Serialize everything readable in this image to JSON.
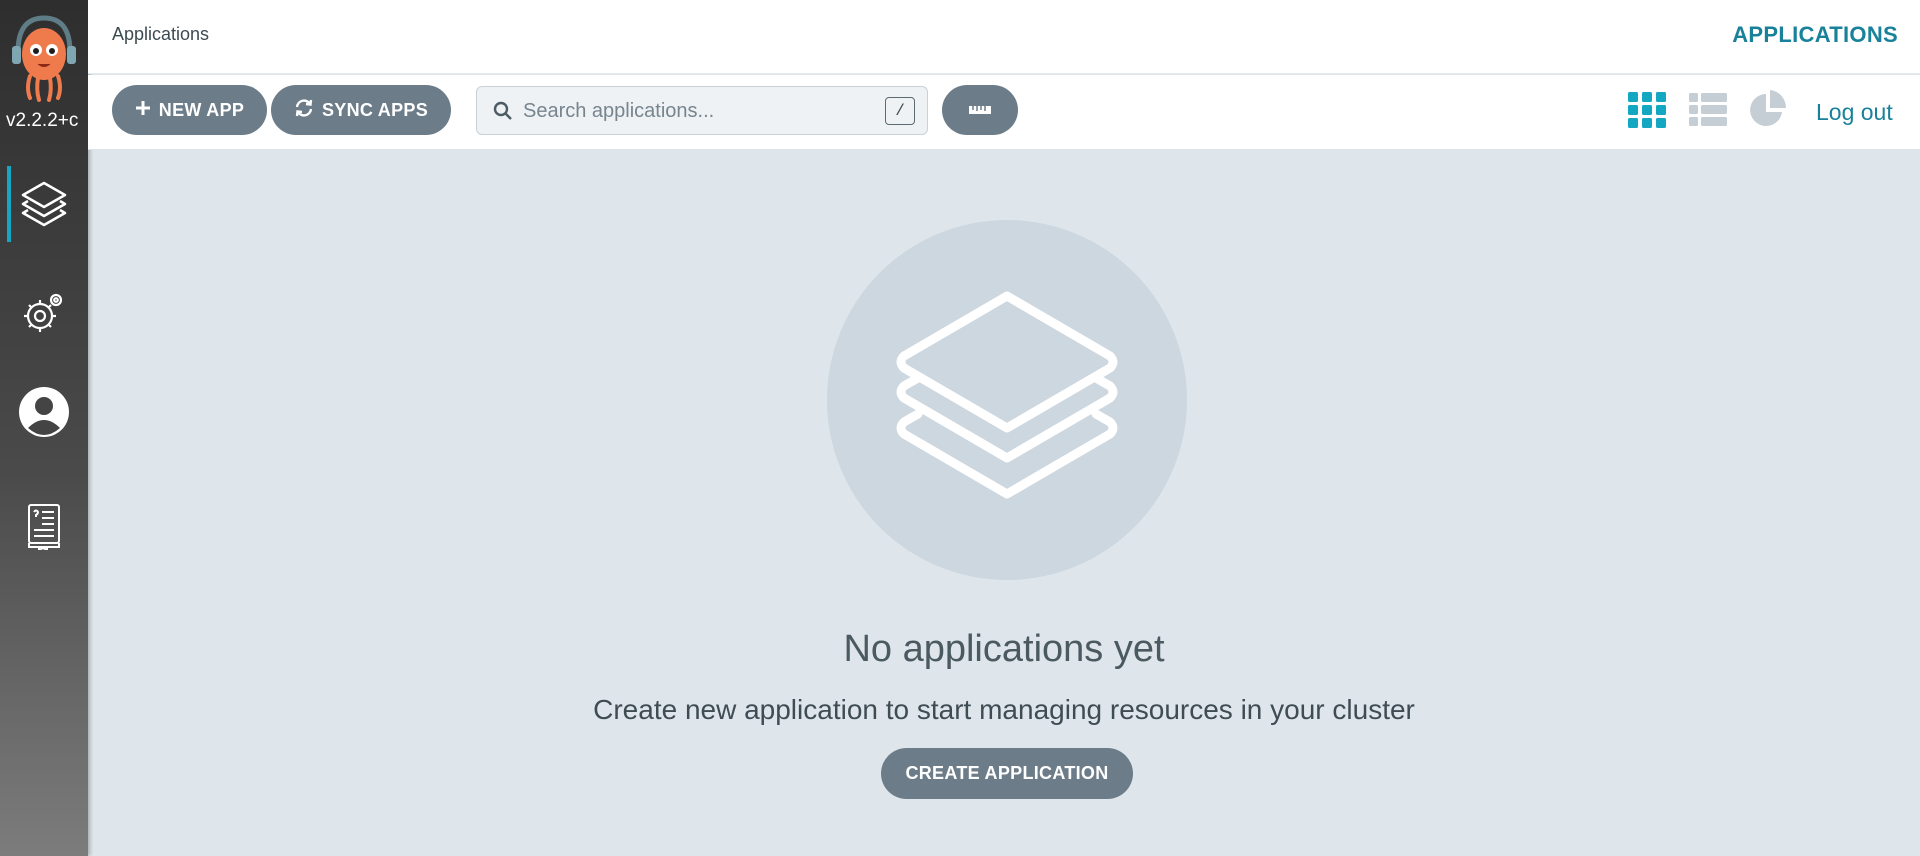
{
  "sidebar": {
    "version": "v2.2.2+c",
    "items": [
      {
        "label": "Applications",
        "icon": "layers-icon",
        "active": true
      },
      {
        "label": "Settings",
        "icon": "gear-icon"
      },
      {
        "label": "User Info",
        "icon": "user-icon"
      },
      {
        "label": "Documentation",
        "icon": "docs-icon"
      }
    ]
  },
  "header": {
    "breadcrumb": "Applications",
    "title": "APPLICATIONS"
  },
  "toolbar": {
    "new_app_label": "NEW APP",
    "sync_apps_label": "SYNC APPS",
    "search_placeholder": "Search applications...",
    "search_shortcut": "/",
    "view_modes": [
      "tiles-view-icon",
      "list-view-icon",
      "summary-view-icon"
    ],
    "active_view": "tiles",
    "logout_label": "Log out"
  },
  "empty_state": {
    "title": "No applications yet",
    "subtitle": "Create new application to start managing resources in your cluster",
    "button_label": "CREATE APPLICATION"
  },
  "colors": {
    "accent": "#19829a",
    "active_tile_icon": "#14a7c2",
    "button_bg": "#6c7d89",
    "page_bg": "#dee6eb",
    "sidebar_bg": "#3a3a3a"
  }
}
